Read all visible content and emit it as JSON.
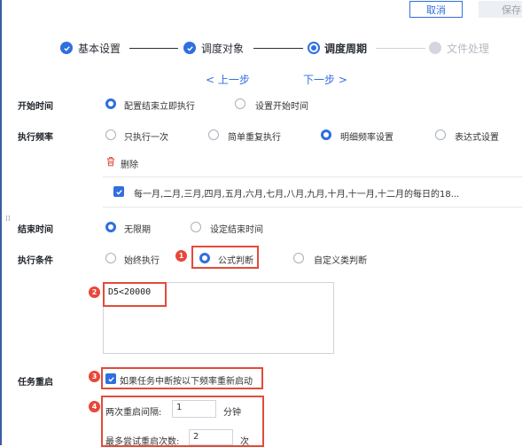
{
  "toolbar": {
    "cancel_label": "取消",
    "save_label": "保存"
  },
  "steps": [
    {
      "label": "基本设置",
      "state": "done"
    },
    {
      "label": "调度对象",
      "state": "done"
    },
    {
      "label": "调度周期",
      "state": "current"
    },
    {
      "label": "文件处理",
      "state": "pending"
    }
  ],
  "nav": {
    "prev_label": "< 上一步",
    "next_label": "下一步 >"
  },
  "start_time": {
    "label": "开始时间",
    "options": [
      "配置结束立即执行",
      "设置开始时间"
    ],
    "selected": "配置结束立即执行"
  },
  "frequency": {
    "label": "执行频率",
    "options": [
      "只执行一次",
      "简单重复执行",
      "明细频率设置",
      "表达式设置"
    ],
    "selected": "明细频率设置",
    "delete_label": "删除",
    "rule_text": "每一月,二月,三月,四月,五月,六月,七月,八月,九月,十月,十一月,十二月的每日的18..."
  },
  "end_time": {
    "label": "结束时间",
    "options": [
      "无限期",
      "设定结束时间"
    ],
    "selected": "无限期"
  },
  "condition": {
    "label": "执行条件",
    "options": [
      "始终执行",
      "公式判断",
      "自定义类判断"
    ],
    "selected": "公式判断",
    "formula_value": "D5<20000"
  },
  "restart": {
    "label": "任务重启",
    "checkbox_label": "如果任务中断按以下频率重新启动",
    "checked": true,
    "interval_label": "两次重启间隔:",
    "interval_value": "1",
    "interval_unit": "分钟",
    "max_label": "最多尝试重启次数:",
    "max_value": "2",
    "max_unit": "次"
  },
  "badges": [
    "1",
    "2",
    "3",
    "4"
  ],
  "colors": {
    "accent": "#2f6fde",
    "annotation": "#e24b3b"
  }
}
